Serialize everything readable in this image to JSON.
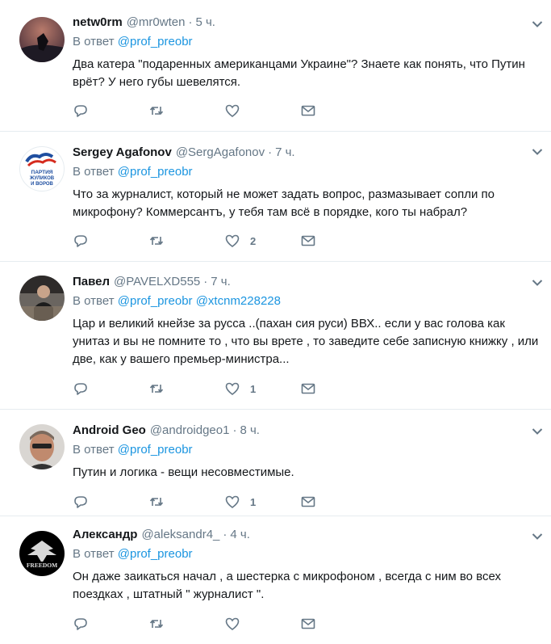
{
  "labels": {
    "reply_prefix": "В ответ"
  },
  "tweets": [
    {
      "name": "netw0rm",
      "handle": "@mr0wten",
      "time": "5 ч.",
      "reply_to": [
        "@prof_preobr"
      ],
      "text": "Два катера \"подаренных американцами Украине\"? Знаете как понять, что Путин врёт? У него губы шевелятся.",
      "replies": "",
      "retweets": "",
      "likes": ""
    },
    {
      "name": "Sergey Agafonov",
      "handle": "@SergAgafonov",
      "time": "7 ч.",
      "reply_to": [
        "@prof_preobr"
      ],
      "text": "Что за журналист, который не может задать вопрос, размазывает сопли по микрофону? Коммерсантъ, у тебя там всё в порядке, кого ты набрал?",
      "avatar_text": [
        "ПАРТИЯ",
        "ЖУЛИКОВ",
        "И ВОРОВ"
      ],
      "replies": "",
      "retweets": "",
      "likes": "2"
    },
    {
      "name": "Павел",
      "handle": "@PAVELXD555",
      "time": "7 ч.",
      "reply_to": [
        "@prof_preobr",
        "@xtcnm228228"
      ],
      "text": "Цар и великий кнейзе за русса ..(пахан сия руси) ВВХ.. если у вас голова как унитаз и вы не помните то , что вы врете , то заведите себе записную книжку , или две, как у вашего премьер-министра...",
      "replies": "",
      "retweets": "",
      "likes": "1"
    },
    {
      "name": "Android Geo",
      "handle": "@androidgeo1",
      "time": "8 ч.",
      "reply_to": [
        "@prof_preobr"
      ],
      "text": "Путин и логика - вещи несовместимые.",
      "replies": "",
      "retweets": "",
      "likes": "1"
    },
    {
      "name": "Александр",
      "handle": "@aleksandr4_",
      "time": "4 ч.",
      "reply_to": [
        "@prof_preobr"
      ],
      "text": "Он даже заикаться начал , а шестерка с микрофоном , всегда с ним во всех поездках , штатный \" журналист \".",
      "avatar_text": [
        "FREEDOM"
      ],
      "replies": "",
      "retweets": "",
      "likes": ""
    }
  ],
  "icons": [
    "reply-icon",
    "retweet-icon",
    "like-icon",
    "message-icon",
    "chevron-down-icon"
  ],
  "colors": {
    "link": "#1b95e0",
    "muted": "#657786",
    "text": "#14171a",
    "divider": "#e6ecf0"
  }
}
